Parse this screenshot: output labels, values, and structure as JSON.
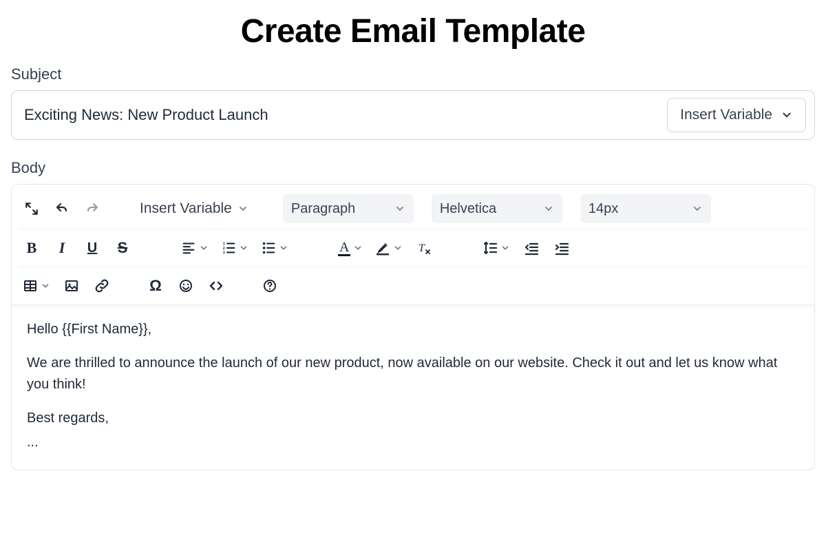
{
  "page": {
    "title": "Create Email Template"
  },
  "subject": {
    "label": "Subject",
    "value": "Exciting News: New Product Launch",
    "insert_variable_label": "Insert Variable"
  },
  "body": {
    "label": "Body",
    "toolbar": {
      "insert_variable_label": "Insert Variable",
      "block_format": "Paragraph",
      "font_family": "Helvetica",
      "font_size": "14px"
    },
    "content": {
      "greeting": "Hello {{First Name}},",
      "paragraph": "We are thrilled to announce the launch of our new product, now available on our website. Check it out and let us know what you think!",
      "signoff": "Best regards,",
      "ellipsis": "..."
    }
  },
  "icons": {
    "expand": "expand",
    "undo": "undo",
    "redo": "redo",
    "bold": "B",
    "italic": "I",
    "underline": "U",
    "strike": "S",
    "align": "align",
    "ol": "ordered-list",
    "ul": "unordered-list",
    "text_color": "A",
    "highlight": "highlight",
    "clear_format": "clear-format",
    "line_height": "line-height",
    "outdent": "outdent",
    "indent": "indent",
    "table": "table",
    "image": "image",
    "link": "link",
    "special_char": "Ω",
    "emoji": "emoji",
    "code": "code",
    "help": "?"
  }
}
